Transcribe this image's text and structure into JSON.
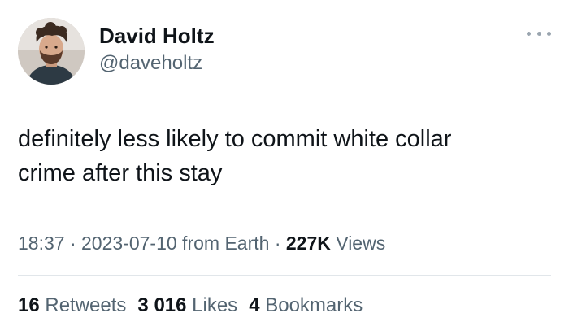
{
  "author": {
    "display_name": "David Holtz",
    "handle": "@daveholtz",
    "avatar_icon": "profile-photo"
  },
  "more_icon": "more-options-icon",
  "tweet": {
    "text": "definitely less likely to commit white collar\ncrime after this stay"
  },
  "meta": {
    "time": "18:37",
    "separator": " · ",
    "date": "2023-07-10",
    "source": " from Earth",
    "separator2": " · ",
    "views_count": "227K",
    "views_label": " Views"
  },
  "stats": {
    "retweets_count": "16",
    "retweets_label": " Retweets",
    "likes_count": "3 016",
    "likes_label": " Likes",
    "bookmarks_count": "4",
    "bookmarks_label": " Bookmarks"
  },
  "colors": {
    "text_primary": "#0f1419",
    "text_secondary": "#536471",
    "divider": "#e1e6ea"
  }
}
